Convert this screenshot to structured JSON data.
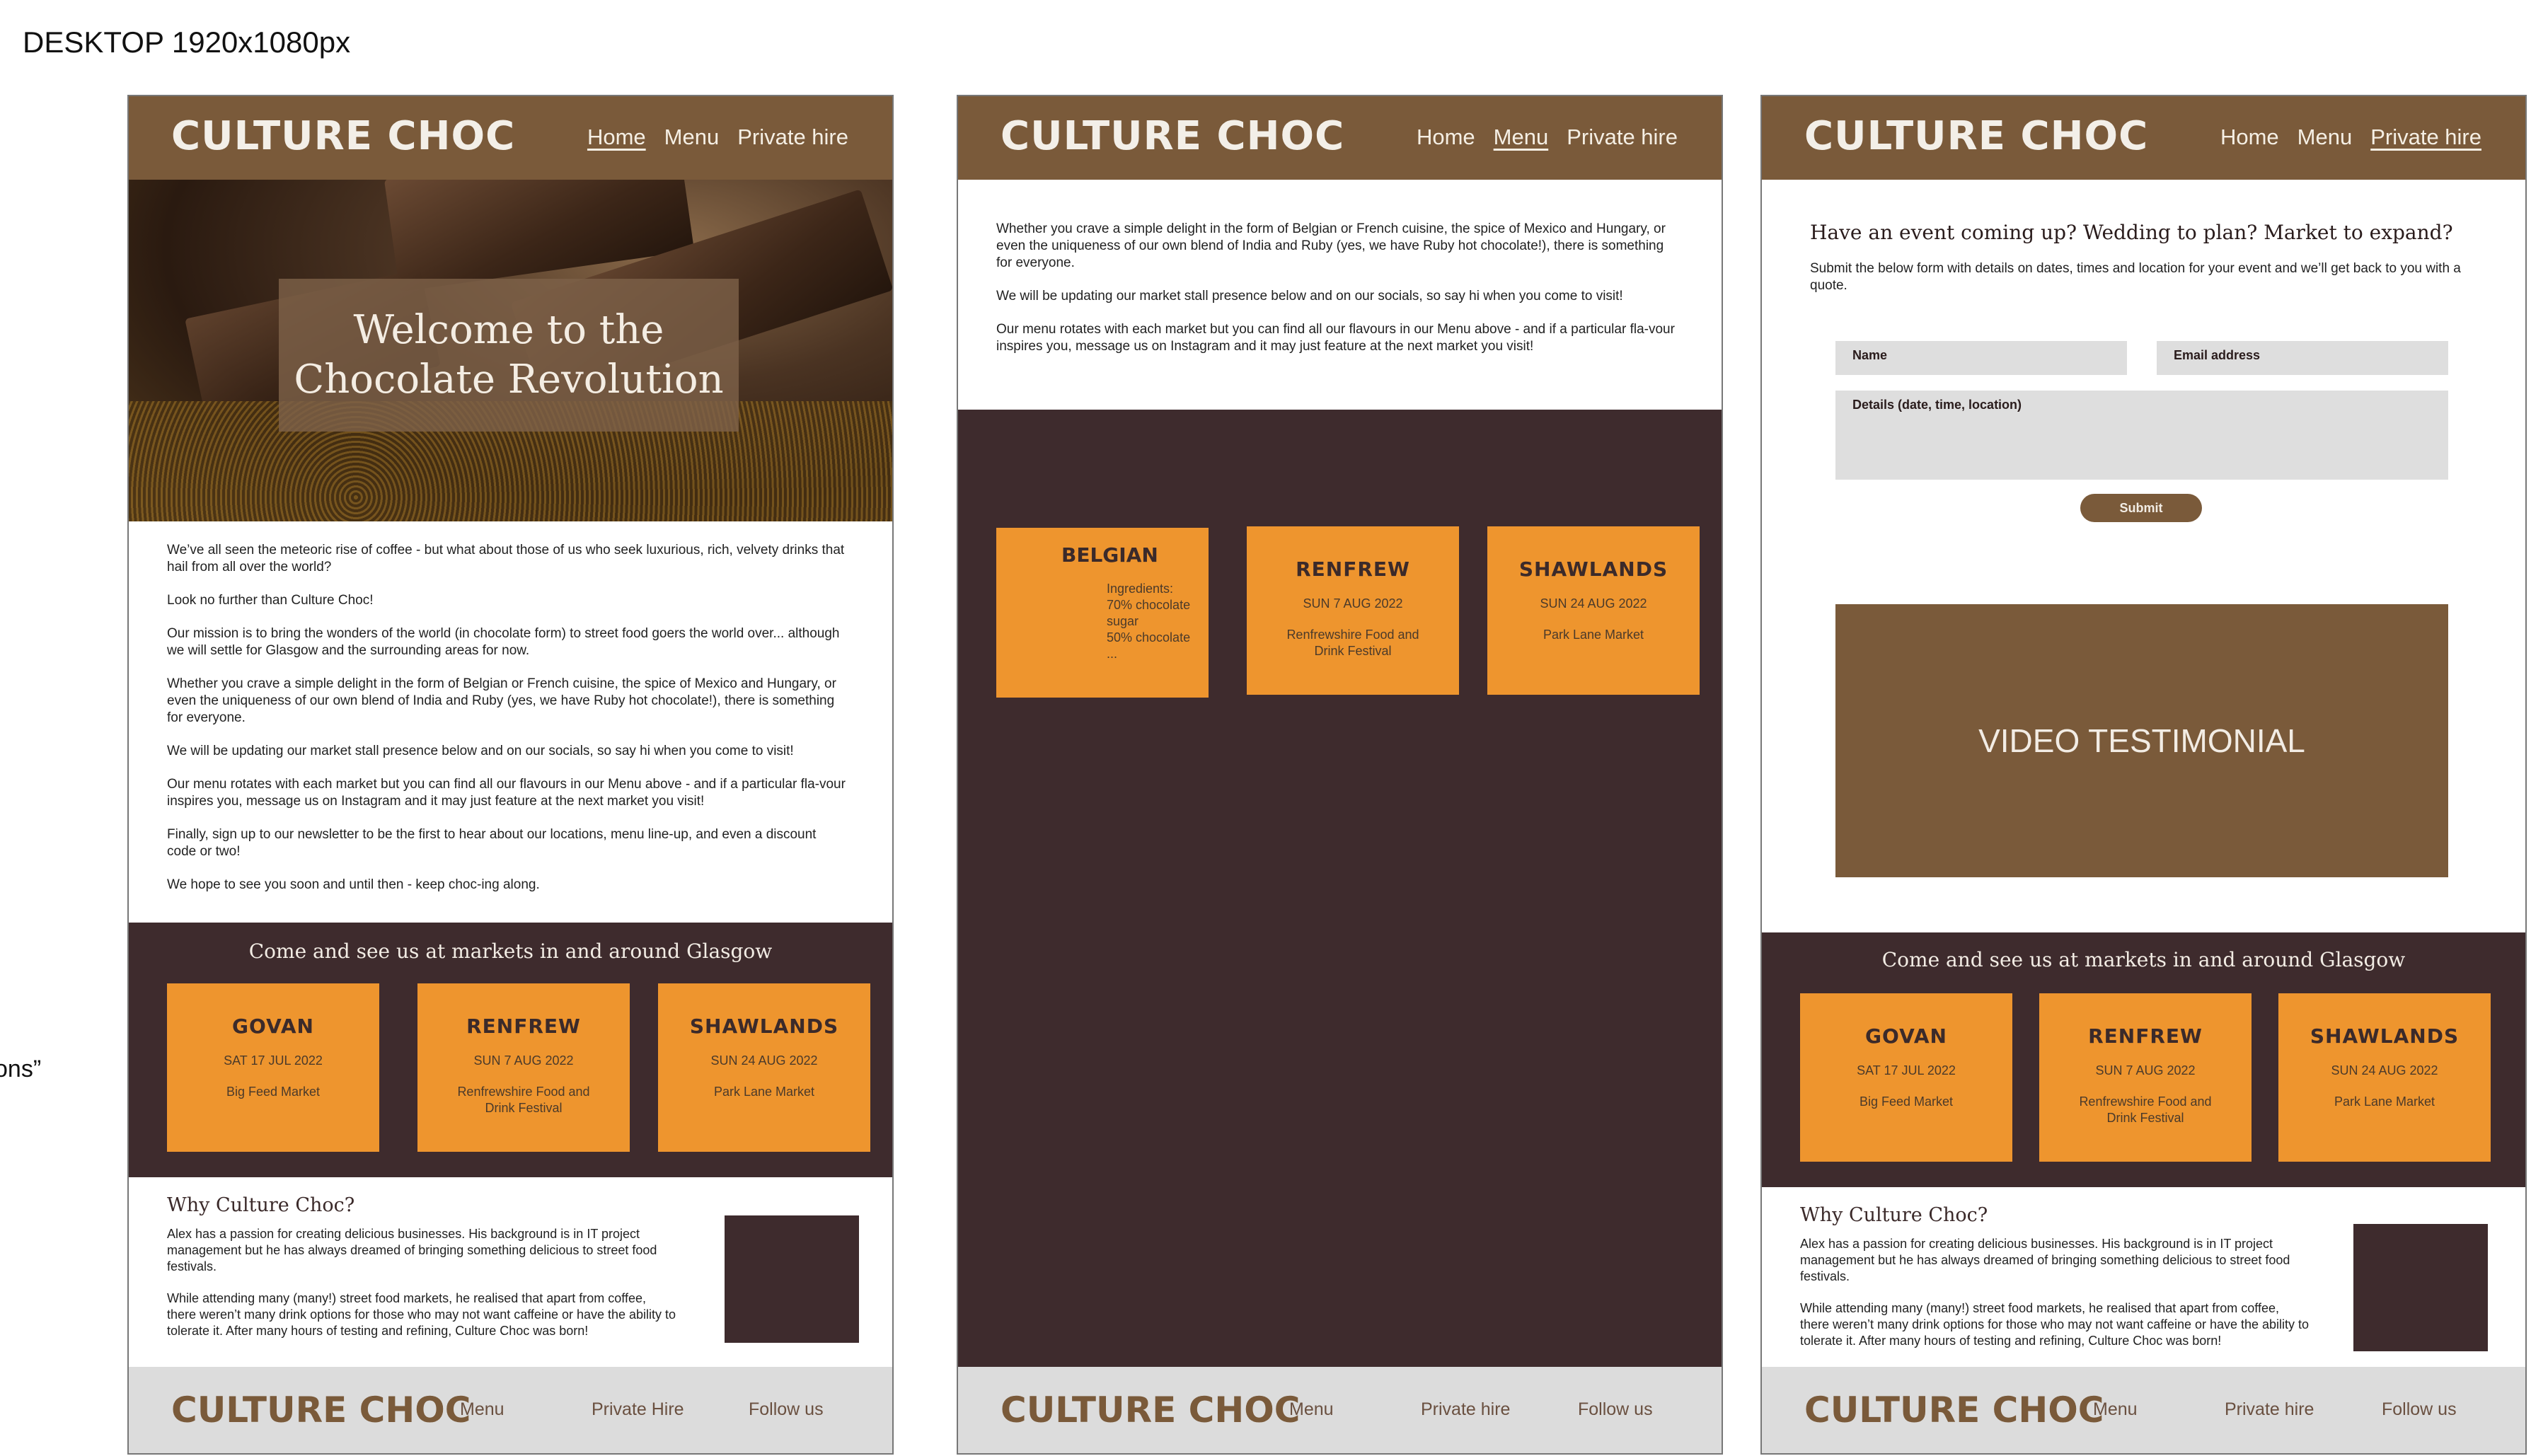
{
  "page_label": "DESKTOP 1920x1080px",
  "side_fragment": "ons”",
  "brand": "CULTURE CHOC",
  "nav": {
    "home": "Home",
    "menu": "Menu",
    "private_hire": "Private hire"
  },
  "hero_title_line1": "Welcome to the",
  "hero_title_line2": "Chocolate Revolution",
  "intro": [
    "We’ve all seen the meteoric rise of coffee - but what about those of us who seek luxurious, rich, velvety drinks that hail from all over the world?",
    "Look no further than Culture Choc!",
    "Our mission is to bring the wonders of the world (in chocolate form) to street food goers the world over... although we will settle for Glasgow and the surrounding areas for now.",
    "Whether you crave a simple delight in the form of Belgian or French cuisine, the spice of Mexico and Hungary, or even the uniqueness of our own blend of India and Ruby (yes, we have Ruby hot chocolate!), there is something for everyone.",
    "We will be updating our market stall presence below and on our socials, so say hi when you come to visit!",
    "Our menu rotates with each market but you can find all our flavours in our Menu above - and if a particular fla-vour inspires you, message us on Instagram and it may just feature at the next market you visit!",
    "Finally, sign up to our newsletter to be the first to hear about our locations, menu line-up, and even a discount code or two!",
    "We hope to see you soon and until then - keep choc-ing along."
  ],
  "markets_title": "Come and see us at markets in and around Glasgow",
  "markets": [
    {
      "name": "GOVAN",
      "date": "SAT 17 JUL 2022",
      "venue": "Big Feed Market"
    },
    {
      "name": "RENFREW",
      "date": "SUN 7 AUG 2022",
      "venue": "Renfrewshire Food and Drink Festival"
    },
    {
      "name": "SHAWLANDS",
      "date": "SUN 24 AUG 2022",
      "venue": "Park Lane Market"
    }
  ],
  "why": {
    "title": "Why Culture Choc?",
    "p1": "Alex has a passion for creating delicious businesses. His background is in IT project management but he has always dreamed of bringing something delicious to street food festivals.",
    "p2": "While attending many (many!) street food markets, he realised that apart from coffee, there weren’t many drink options for those who may not want caffeine or have the ability to tolerate it. After many hours of testing and refining, Culture Choc was born!"
  },
  "footer": {
    "menu": "Menu",
    "private_hire_a": "Private Hire",
    "private_hire_b": "Private hire",
    "follow": "Follow us"
  },
  "menu_page": {
    "text": [
      "Whether you crave a simple delight in the form of Belgian or French cuisine, the spice of Mexico and Hungary, or even the uniqueness of our own blend of India and Ruby (yes, we have Ruby hot chocolate!), there is something for everyone.",
      "We will be updating our market stall presence below and on our socials, so say hi when you come to visit!",
      "Our menu rotates with each market but you can find all our flavours in our Menu above - and if a particular fla-vour inspires you, message us on Instagram and it may just feature at the next market you visit!"
    ],
    "belgian": {
      "name": "BELGIAN",
      "ingredients": [
        "Ingredients:",
        "70% chocolate",
        "sugar",
        "50% chocolate",
        "..."
      ]
    }
  },
  "hire_page": {
    "heading": "Have an event coming up? Wedding to plan? Market to expand?",
    "para": "Submit the below form with details on dates, times and location for your event and we’ll get back to you with a quote.",
    "name_ph": "Name",
    "email_ph": "Email address",
    "details_ph": "Details (date, time, location)",
    "submit": "Submit",
    "video": "VIDEO TESTIMONIAL"
  },
  "colors": {
    "brown": "#7a5a3a",
    "dark": "#3e2b2d",
    "orange": "#ee952e",
    "footer": "#dcdcdc"
  }
}
